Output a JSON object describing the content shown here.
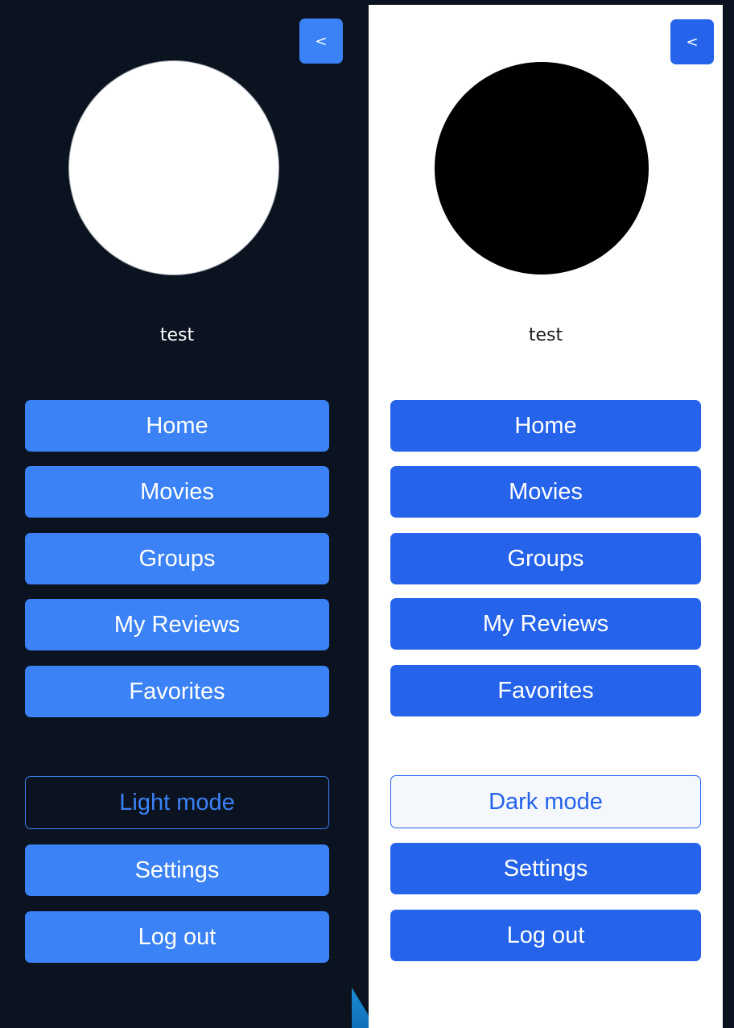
{
  "colors": {
    "page_background": "#0b1320",
    "dark_panel_background": "#0b1220",
    "light_panel_background": "#ffffff",
    "dark_accent": "#3b82f6",
    "light_accent": "#2563eb"
  },
  "dark_panel": {
    "collapse_label": "<",
    "username": "test",
    "nav": {
      "home": "Home",
      "movies": "Movies",
      "groups": "Groups",
      "my_reviews": "My Reviews",
      "favorites": "Favorites"
    },
    "mode_toggle": "Light mode",
    "settings": "Settings",
    "logout": "Log out"
  },
  "light_panel": {
    "collapse_label": "<",
    "username": "test",
    "nav": {
      "home": "Home",
      "movies": "Movies",
      "groups": "Groups",
      "my_reviews": "My Reviews",
      "favorites": "Favorites"
    },
    "mode_toggle": "Dark mode",
    "settings": "Settings",
    "logout": "Log out"
  }
}
